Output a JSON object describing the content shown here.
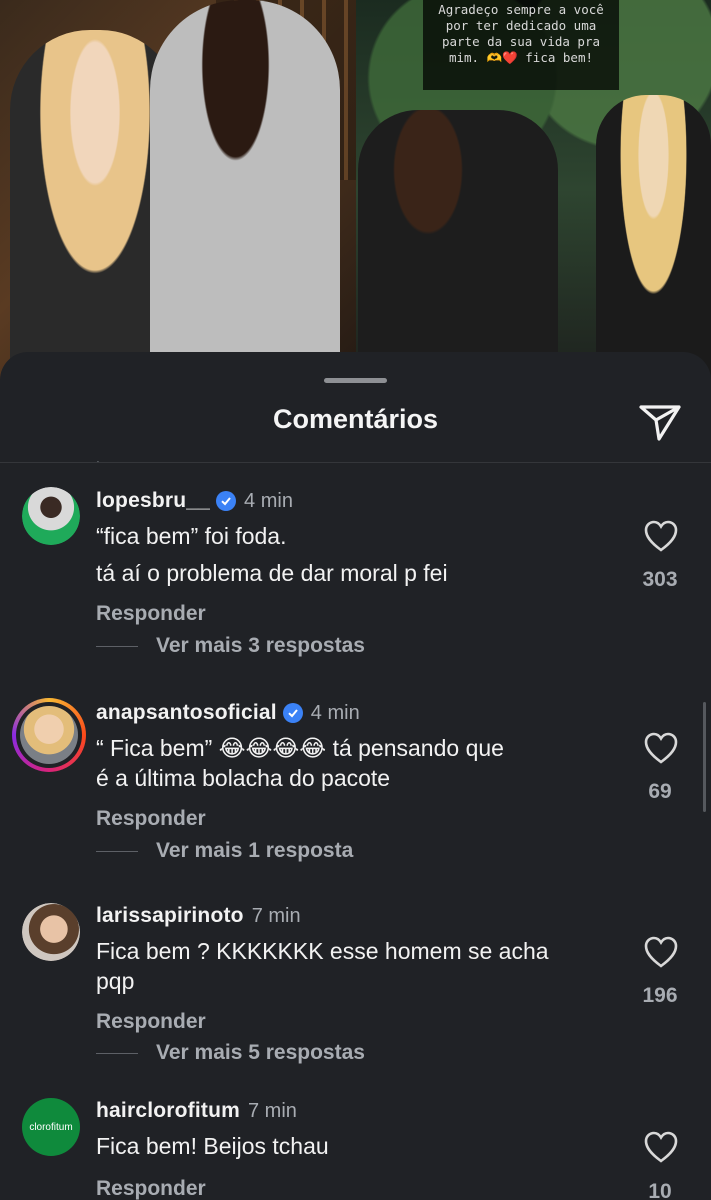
{
  "story": {
    "caption": "Agradeço sempre a você por ter dedicado uma parte da sua vida pra mim. 🫶❤️ fica bem!"
  },
  "sheet": {
    "title": "Comentários",
    "cut_glimpse": "."
  },
  "comments": [
    {
      "username": "lopesbru__",
      "verified": true,
      "time": "4 min",
      "text_lines": [
        "“fica bem” foi foda.",
        "tá aí o problema de dar moral p fei"
      ],
      "reply_label": "Responder",
      "more_replies": "Ver mais 3 respostas",
      "likes": "303"
    },
    {
      "username": "anapsantosoficial",
      "verified": true,
      "time": "4 min",
      "text_lines": [
        "“ Fica bem” 😂😂😂😂 tá pensando que",
        "é a última bolacha do pacote"
      ],
      "reply_label": "Responder",
      "more_replies": "Ver mais 1 resposta",
      "likes": "69"
    },
    {
      "username": "larissapirinoto",
      "verified": false,
      "time": "7 min",
      "text_lines": [
        "Fica bem ? KKKKKKK esse homem se acha",
        "pqp"
      ],
      "reply_label": "Responder",
      "more_replies": "Ver mais 5 respostas",
      "likes": "196"
    },
    {
      "username": "hairclorofitum",
      "verified": false,
      "time": "7 min",
      "text_lines": [
        "Fica bem! Beijos tchau"
      ],
      "reply_label": "Responder",
      "avatar_text": "clorofitum",
      "likes": "10"
    }
  ]
}
